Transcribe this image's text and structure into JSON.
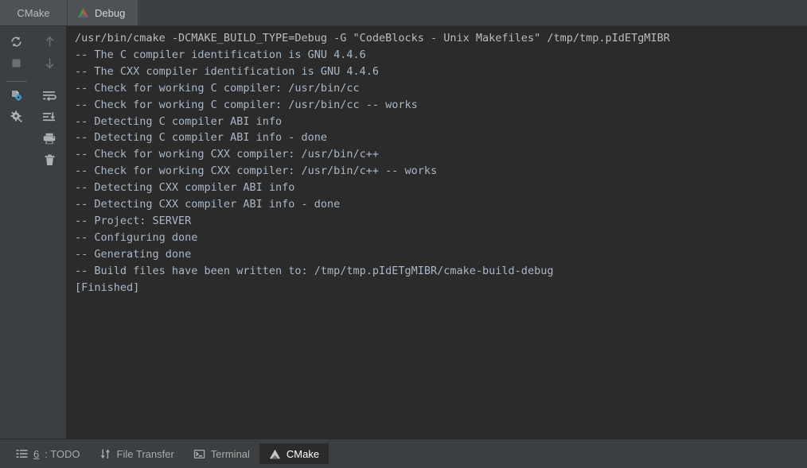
{
  "window": {
    "panel_title": "CMake"
  },
  "tabs": {
    "items": [
      {
        "label": "Debug",
        "icon": "cmake-triangle-icon",
        "active": true
      }
    ]
  },
  "toolbar": {
    "left_column": [
      {
        "name": "rerun-cmake-button",
        "icon": "refresh-icon",
        "label": "Rerun CMake"
      },
      {
        "name": "stop-button",
        "icon": "stop-square-icon",
        "label": "Stop"
      },
      {
        "name": "cmake-settings-button",
        "icon": "file-gear-icon",
        "label": "CMake Settings"
      },
      {
        "name": "settings-dropdown-button",
        "icon": "gear-dropdown-icon",
        "label": "Settings"
      }
    ],
    "right_column": [
      {
        "name": "previous-occurrence-button",
        "icon": "arrow-up-icon",
        "label": "Up the Stack Trace"
      },
      {
        "name": "next-occurrence-button",
        "icon": "arrow-down-icon",
        "label": "Down the Stack Trace"
      },
      {
        "name": "soft-wrap-button",
        "icon": "soft-wrap-icon",
        "label": "Soft-Wrap"
      },
      {
        "name": "scroll-to-end-button",
        "icon": "scroll-to-end-icon",
        "label": "Scroll to the end"
      },
      {
        "name": "print-button",
        "icon": "printer-icon",
        "label": "Print"
      },
      {
        "name": "clear-all-button",
        "icon": "trash-icon",
        "label": "Clear All"
      }
    ]
  },
  "console": {
    "lines": [
      "/usr/bin/cmake -DCMAKE_BUILD_TYPE=Debug -G \"CodeBlocks - Unix Makefiles\" /tmp/tmp.pIdETgMIBR",
      "-- The C compiler identification is GNU 4.4.6",
      "-- The CXX compiler identification is GNU 4.4.6",
      "-- Check for working C compiler: /usr/bin/cc",
      "-- Check for working C compiler: /usr/bin/cc -- works",
      "-- Detecting C compiler ABI info",
      "-- Detecting C compiler ABI info - done",
      "-- Check for working CXX compiler: /usr/bin/c++",
      "-- Check for working CXX compiler: /usr/bin/c++ -- works",
      "-- Detecting CXX compiler ABI info",
      "-- Detecting CXX compiler ABI info - done",
      "-- Project: SERVER",
      "-- Configuring done",
      "-- Generating done",
      "-- Build files have been written to: /tmp/tmp.pIdETgMIBR/cmake-build-debug",
      "",
      "[Finished]"
    ]
  },
  "statusbar": {
    "items": [
      {
        "name": "todo",
        "number": "6",
        "label": ": TODO",
        "icon": "list-icon",
        "active": false
      },
      {
        "name": "file-transfer",
        "number": "",
        "label": "File Transfer",
        "icon": "transfer-arrows-icon",
        "active": false
      },
      {
        "name": "terminal",
        "number": "",
        "label": "Terminal",
        "icon": "terminal-prompt-icon",
        "active": false
      },
      {
        "name": "cmake",
        "number": "",
        "label": "CMake",
        "icon": "cmake-grey-triangle-icon",
        "active": true
      }
    ]
  },
  "colors": {
    "panel_bg": "#3c3f41",
    "console_bg": "#2b2b2b",
    "tab_bg": "#4e5254",
    "text": "#a9b7c6",
    "icon": "#afb1b3",
    "accent_blue": "#389fd6",
    "cmake_red": "#d14836",
    "cmake_green": "#3c9c3c",
    "cmake_blue": "#4a7ebb"
  }
}
